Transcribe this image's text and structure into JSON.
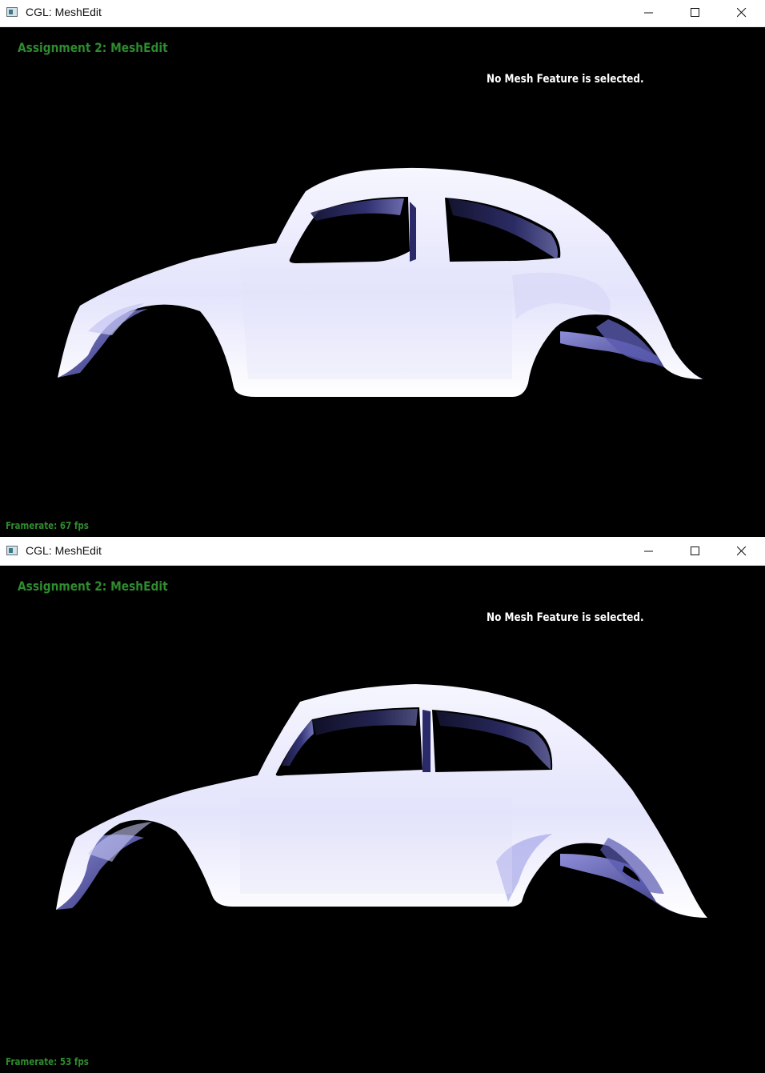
{
  "windows": [
    {
      "title": "CGL: MeshEdit",
      "hud_title": "Assignment 2: MeshEdit",
      "status": "No Mesh Feature is selected.",
      "framerate": "Framerate: 67 fps"
    },
    {
      "title": "CGL: MeshEdit",
      "hud_title": "Assignment 2: MeshEdit",
      "status": "No Mesh Feature is selected.",
      "framerate": "Framerate: 53 fps"
    }
  ],
  "icons": {
    "app": "app-window-icon",
    "minimize": "minimize-icon",
    "maximize": "maximize-icon",
    "close": "close-icon"
  },
  "colors": {
    "hud_green": "#2e8b2e",
    "background": "#000000",
    "mesh_light": "#f2f2ff",
    "mesh_shadow": "#3a3a8a"
  }
}
